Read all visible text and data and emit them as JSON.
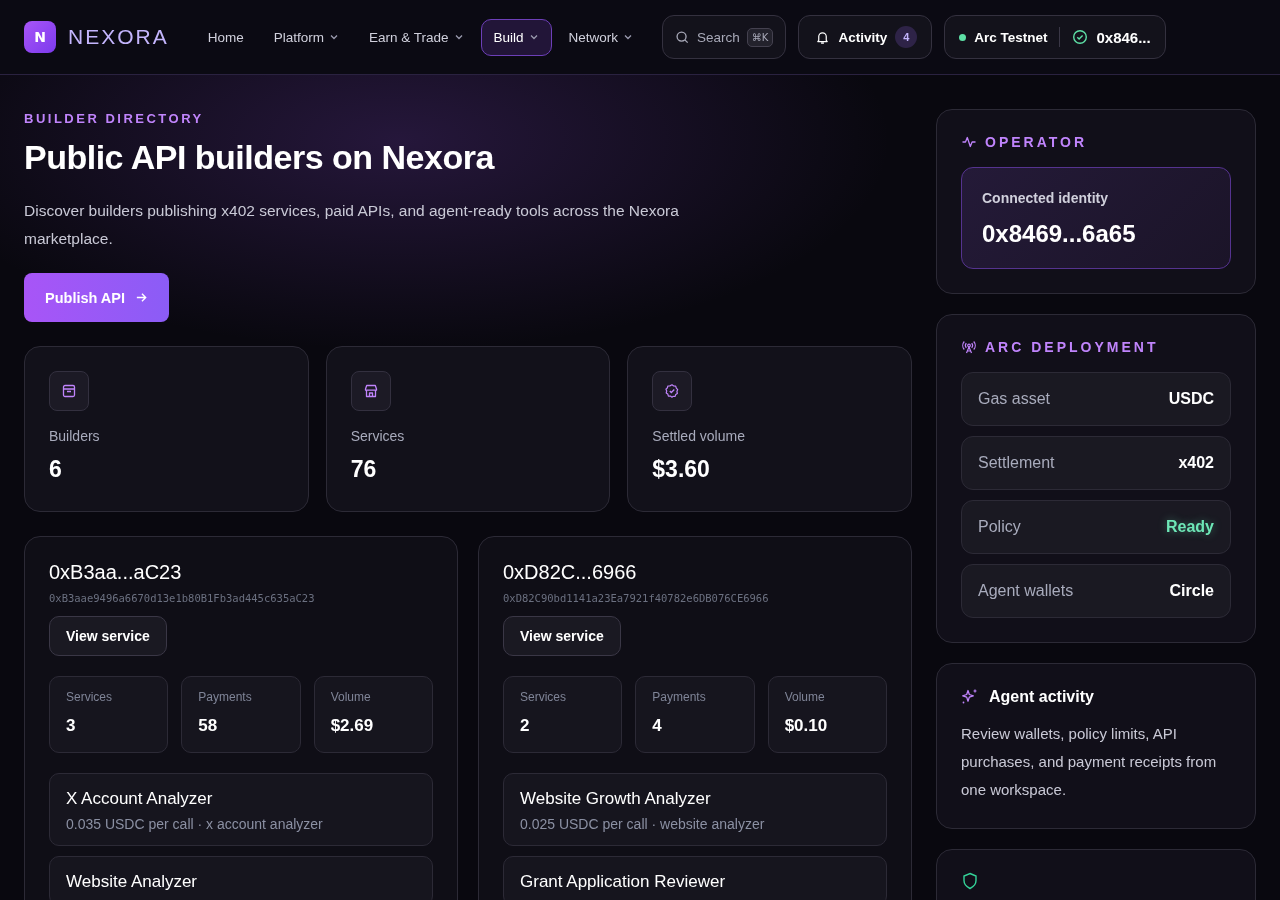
{
  "brand": {
    "mark": "N",
    "name": "NEXORA"
  },
  "nav": [
    {
      "label": "Home",
      "dropdown": false,
      "selected": false
    },
    {
      "label": "Platform",
      "dropdown": true,
      "selected": false
    },
    {
      "label": "Earn & Trade",
      "dropdown": true,
      "selected": false
    },
    {
      "label": "Build",
      "dropdown": true,
      "selected": true
    },
    {
      "label": "Network",
      "dropdown": true,
      "selected": false
    }
  ],
  "search": {
    "placeholder": "Search",
    "shortcut": "⌘K"
  },
  "activity": {
    "label": "Activity",
    "count": "4"
  },
  "network": {
    "name": "Arc Testnet",
    "online": true,
    "account": "0x846..."
  },
  "hero": {
    "eyebrow": "BUILDER DIRECTORY",
    "title": "Public API builders on Nexora",
    "description": "Discover builders publishing x402 services, paid APIs, and agent-ready tools across the Nexora marketplace.",
    "button": "Publish API"
  },
  "stats": [
    {
      "kind": "box",
      "label": "Builders",
      "value": "6"
    },
    {
      "kind": "store",
      "label": "Services",
      "value": "76"
    },
    {
      "kind": "badge",
      "label": "Settled volume",
      "value": "$3.60"
    }
  ],
  "builders": [
    {
      "short": "0xB3aa...aC23",
      "address": "0xB3aae9496a6670d13e1b80B1Fb3ad445c635aC23",
      "button": "View service",
      "metrics": [
        {
          "label": "Services",
          "value": "3"
        },
        {
          "label": "Payments",
          "value": "58"
        },
        {
          "label": "Volume",
          "value": "$2.69"
        }
      ],
      "services": [
        {
          "name": "X Account Analyzer",
          "detail": "0.035 USDC per call · x account analyzer"
        },
        {
          "name": "Website Analyzer"
        }
      ]
    },
    {
      "short": "0xD82C...6966",
      "address": "0xD82C90bd1141a23Ea7921f40782e6DB076CE6966",
      "button": "View service",
      "metrics": [
        {
          "label": "Services",
          "value": "2"
        },
        {
          "label": "Payments",
          "value": "4"
        },
        {
          "label": "Volume",
          "value": "$0.10"
        }
      ],
      "services": [
        {
          "name": "Website Growth Analyzer",
          "detail": "0.025 USDC per call · website analyzer"
        },
        {
          "name": "Grant Application Reviewer"
        }
      ]
    }
  ],
  "operator": {
    "title": "OPERATOR",
    "label": "Connected identity",
    "identity": "0x8469...6a65"
  },
  "deployment": {
    "title": "ARC DEPLOYMENT",
    "rows": [
      {
        "label": "Gas asset",
        "value": "USDC",
        "kind": "plain"
      },
      {
        "label": "Settlement",
        "value": "x402",
        "kind": "plain"
      },
      {
        "label": "Policy",
        "value": "Ready",
        "kind": "status"
      },
      {
        "label": "Agent wallets",
        "value": "Circle",
        "kind": "plain"
      }
    ]
  },
  "agent": {
    "title": "Agent activity",
    "text": "Review wallets, policy limits, API purchases, and payment receipts from one workspace."
  }
}
